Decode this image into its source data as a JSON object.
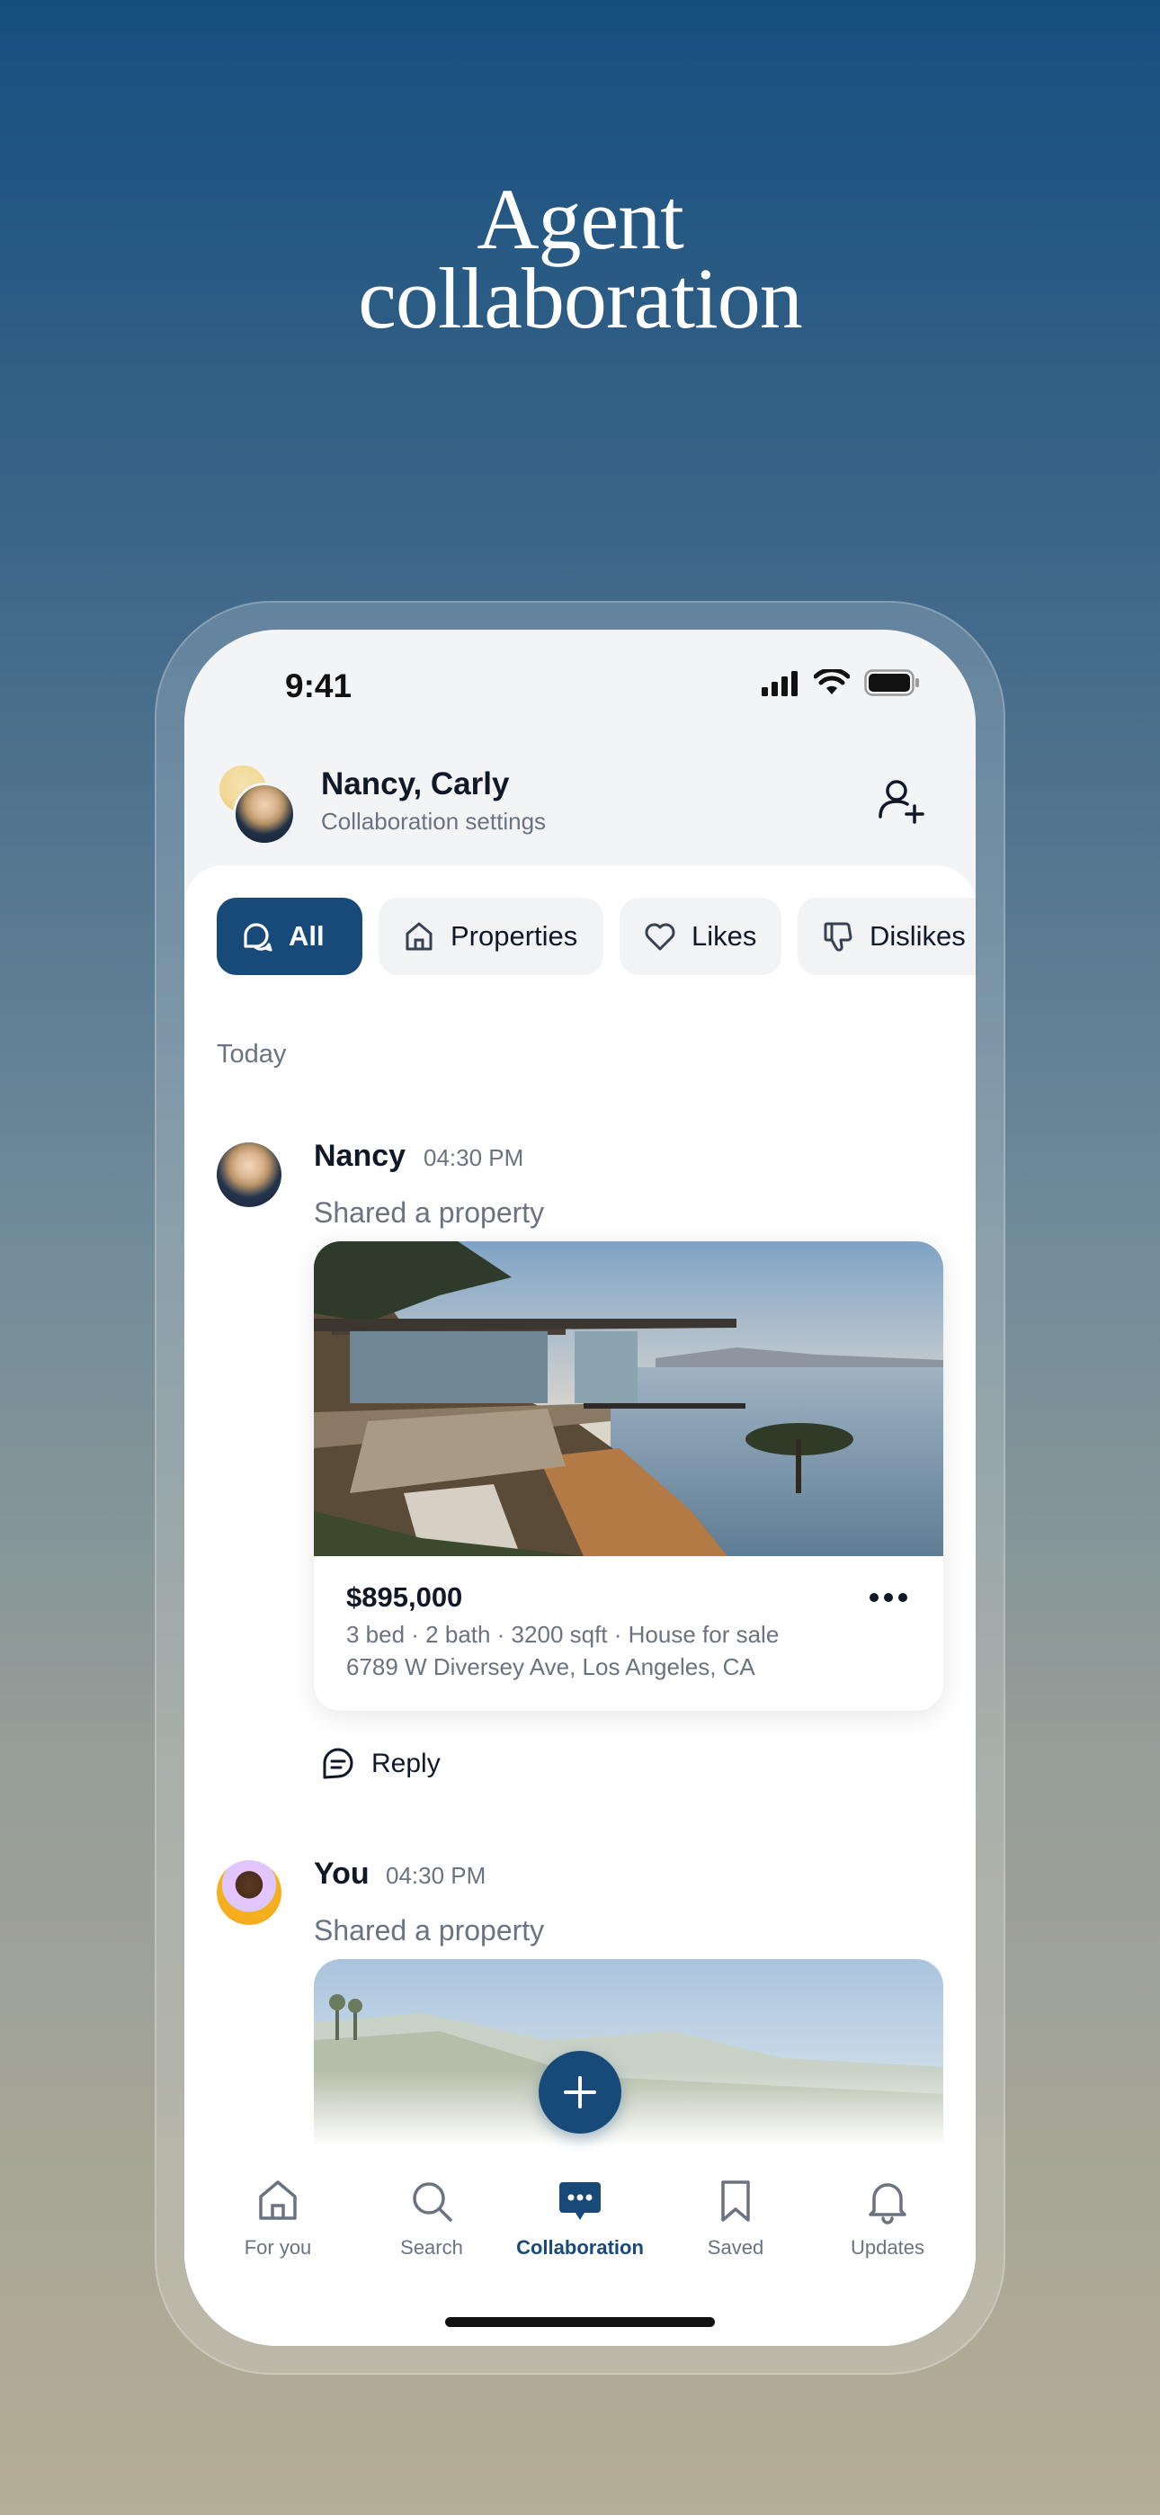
{
  "headline": {
    "line1": "Agent",
    "line2": "collaboration"
  },
  "status_bar": {
    "time": "9:41"
  },
  "conversation": {
    "participants": "Nancy, Carly",
    "settings_label": "Collaboration settings"
  },
  "filters": [
    {
      "label": "All",
      "icon": "chat-bubbles-icon",
      "selected": true
    },
    {
      "label": "Properties",
      "icon": "house-icon",
      "selected": false
    },
    {
      "label": "Likes",
      "icon": "heart-icon",
      "selected": false
    },
    {
      "label": "Dislikes",
      "icon": "thumbs-down-icon",
      "selected": false
    }
  ],
  "feed": {
    "day": "Today",
    "messages": [
      {
        "author": "Nancy",
        "time": "04:30 PM",
        "action": "Shared a property",
        "property": {
          "price": "$895,000",
          "details": "3 bed · 2 bath · 3200 sqft · House for sale",
          "address": "6789 W Diversey Ave, Los Angeles, CA"
        },
        "reply_label": "Reply"
      },
      {
        "author": "You",
        "time": "04:30 PM",
        "action": "Shared a property"
      }
    ]
  },
  "tabbar": [
    {
      "label": "For you",
      "icon": "home-icon",
      "active": false
    },
    {
      "label": "Search",
      "icon": "search-icon",
      "active": false
    },
    {
      "label": "Collaboration",
      "icon": "chat-icon",
      "active": true
    },
    {
      "label": "Saved",
      "icon": "bookmark-icon",
      "active": false
    },
    {
      "label": "Updates",
      "icon": "bell-icon",
      "active": false
    }
  ],
  "colors": {
    "accent": "#174a78",
    "text_primary": "#111827",
    "text_secondary": "#6b7280"
  }
}
